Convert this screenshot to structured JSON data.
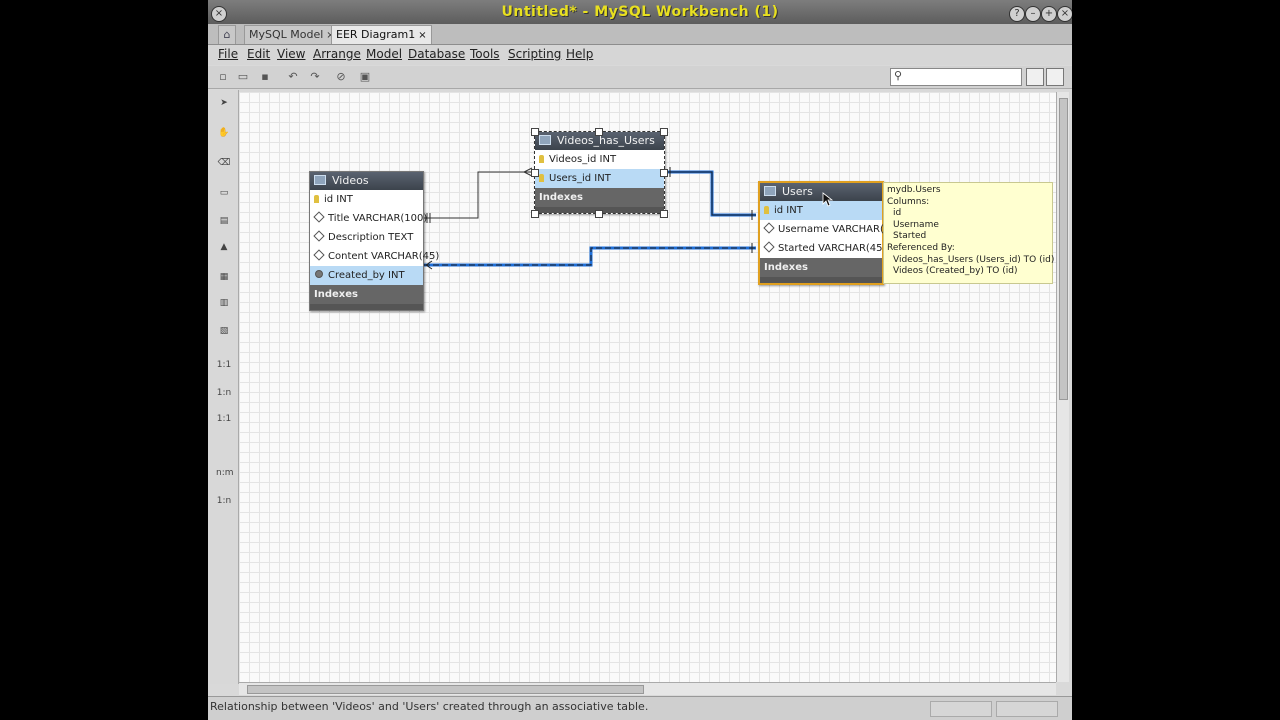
{
  "window": {
    "title": "Untitled* - MySQL Workbench (1)"
  },
  "tabs": [
    {
      "label": "MySQL Model",
      "close": "×"
    },
    {
      "label": "EER Diagram1",
      "close": "×"
    }
  ],
  "menu": [
    "File",
    "Edit",
    "View",
    "Arrange",
    "Model",
    "Database",
    "Tools",
    "Scripting",
    "Help"
  ],
  "toolbar": {
    "icons": [
      "new-icon",
      "open-icon",
      "save-icon",
      "undo-icon",
      "redo-icon",
      "toggle-grid-icon",
      "align-icon"
    ],
    "search_placeholder": ""
  },
  "palette": {
    "tools": [
      "select-icon",
      "hand-icon",
      "eraser-icon",
      "layer-icon",
      "note-icon",
      "image-icon",
      "table-icon",
      "view-icon",
      "routine-group-icon",
      "rel-1-1-icon",
      "rel-1-n-icon",
      "rel-1-1-nonid-icon",
      "rel-n-m-icon",
      "rel-1-n-existing-icon"
    ],
    "labels": [
      "1:1",
      "1:n",
      "1:1",
      "n:m",
      "1:n"
    ]
  },
  "tables": {
    "videos": {
      "name": "Videos",
      "columns": [
        "id INT",
        "Title VARCHAR(100)",
        "Description TEXT",
        "Content VARCHAR(45)",
        "Created_by INT"
      ],
      "indexes": "Indexes"
    },
    "videos_has_users": {
      "name": "Videos_has_Users",
      "columns": [
        "Videos_id INT",
        "Users_id INT"
      ],
      "indexes": "Indexes"
    },
    "users": {
      "name": "Users",
      "columns": [
        "id INT",
        "Username VARCHAR(45)",
        "Started VARCHAR(45)"
      ],
      "indexes": "Indexes"
    }
  },
  "tooltip": {
    "lines": [
      "mydb.Users",
      "Columns:",
      " id",
      " Username",
      " Started",
      "Referenced By:",
      " Videos_has_Users (Users_id) TO (id)",
      " Videos (Created_by) TO (id)"
    ]
  },
  "status": {
    "message": "Relationship between 'Videos' and 'Users' created through an associative table."
  },
  "colors": {
    "title_text": "#e8e020",
    "table_header": "#4b535d",
    "selected_row": "#b9daf5",
    "relationship_highlight": "#1e6fd9",
    "tooltip_bg": "#ffffd0",
    "users_border": "#e0a020"
  }
}
